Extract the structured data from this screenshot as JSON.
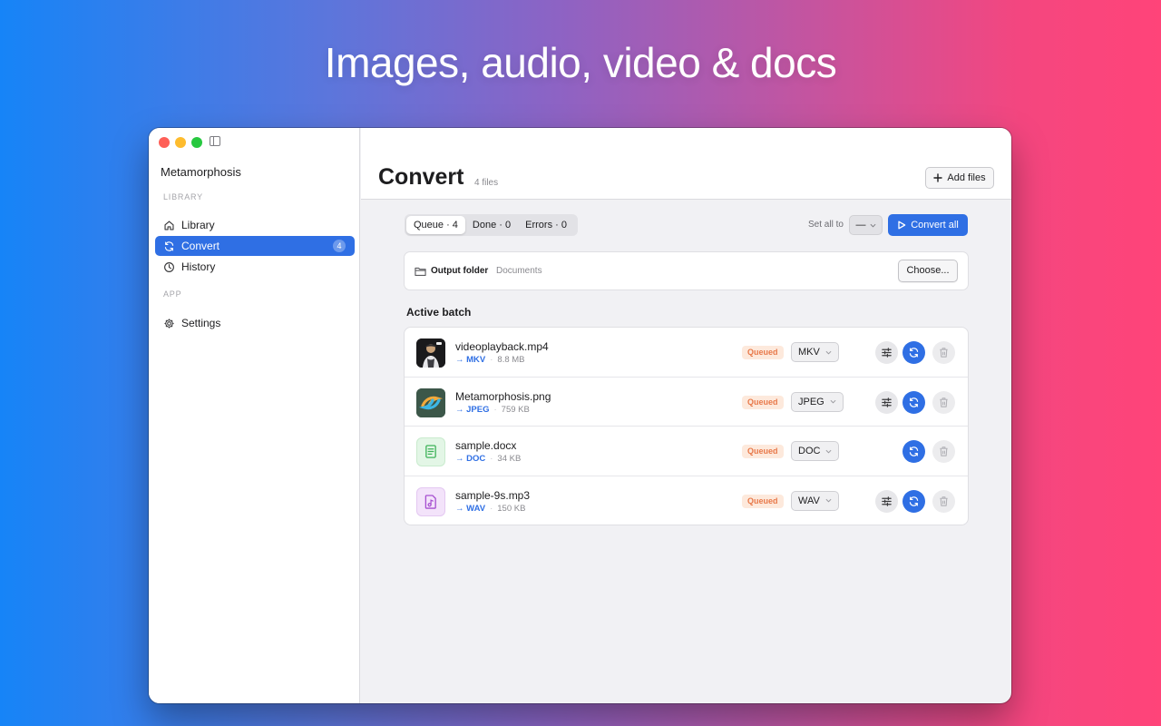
{
  "headline": "Images, audio, video & docs",
  "sidebar": {
    "app_name": "Metamorphosis",
    "sections": [
      {
        "label": "LIBRARY"
      },
      {
        "label": "APP"
      }
    ],
    "items": [
      {
        "label": "Library",
        "icon": "house-icon"
      },
      {
        "label": "Convert",
        "icon": "convert-cycle-icon",
        "badge": "4",
        "active": true
      },
      {
        "label": "History",
        "icon": "clock-icon"
      },
      {
        "label": "Settings",
        "icon": "gear-icon"
      }
    ]
  },
  "header": {
    "title": "Convert",
    "count": "4 files",
    "add_files_label": "Add files"
  },
  "tabs": [
    {
      "label": "Queue · 4",
      "selected": true
    },
    {
      "label": "Done · 0"
    },
    {
      "label": "Errors · 0"
    }
  ],
  "set_all": {
    "label": "Set all to",
    "value": "—"
  },
  "convert_all_label": "Convert all",
  "output": {
    "label": "Output folder",
    "value": "Documents",
    "choose_label": "Choose..."
  },
  "batch": {
    "title": "Active batch",
    "files": [
      {
        "name": "videoplayback.mp4",
        "target": "→ MKV",
        "size": "8.8 MB",
        "status": "Queued",
        "format": "MKV",
        "thumb": "video-thumbnail",
        "has_settings": true
      },
      {
        "name": "Metamorphosis.png",
        "target": "→ JPEG",
        "size": "759 KB",
        "status": "Queued",
        "format": "JPEG",
        "thumb": "app-logo-thumbnail",
        "has_settings": true
      },
      {
        "name": "sample.docx",
        "target": "→ DOC",
        "size": "34 KB",
        "status": "Queued",
        "format": "DOC",
        "thumb": "document-icon",
        "has_settings": false
      },
      {
        "name": "sample-9s.mp3",
        "target": "→ WAV",
        "size": "150 KB",
        "status": "Queued",
        "format": "WAV",
        "thumb": "audio-file-icon",
        "has_settings": true
      }
    ]
  },
  "colors": {
    "accent": "#2f6fe4",
    "status_queued_bg": "#fde9dc",
    "status_queued_text": "#e8794a"
  }
}
